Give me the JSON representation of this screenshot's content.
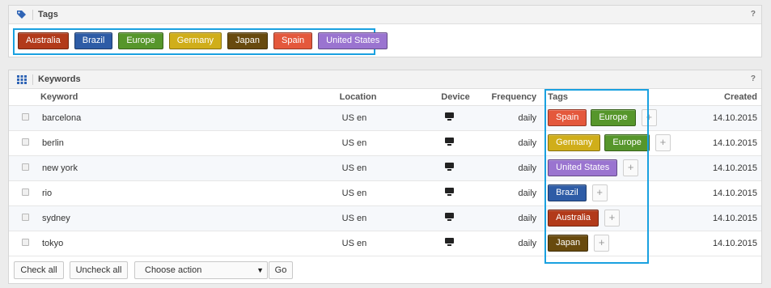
{
  "tags_panel": {
    "title": "Tags",
    "help": "?",
    "tags": [
      {
        "label": "Australia",
        "color": "#b23a1a"
      },
      {
        "label": "Brazil",
        "color": "#2e5ca6"
      },
      {
        "label": "Europe",
        "color": "#56962b"
      },
      {
        "label": "Germany",
        "color": "#d0ae1a"
      },
      {
        "label": "Japan",
        "color": "#684a0e"
      },
      {
        "label": "Spain",
        "color": "#e4583c"
      },
      {
        "label": "United States",
        "color": "#9a74d0"
      }
    ]
  },
  "keywords_panel": {
    "title": "Keywords",
    "help": "?",
    "columns": {
      "keyword": "Keyword",
      "location": "Location",
      "device": "Device",
      "frequency": "Frequency",
      "tags": "Tags",
      "created": "Created"
    },
    "rows": [
      {
        "keyword": "barcelona",
        "location": "US en",
        "frequency": "daily",
        "created": "14.10.2015",
        "tags": [
          "Spain",
          "Europe"
        ]
      },
      {
        "keyword": "berlin",
        "location": "US en",
        "frequency": "daily",
        "created": "14.10.2015",
        "tags": [
          "Germany",
          "Europe"
        ]
      },
      {
        "keyword": "new york",
        "location": "US en",
        "frequency": "daily",
        "created": "14.10.2015",
        "tags": [
          "United States"
        ]
      },
      {
        "keyword": "rio",
        "location": "US en",
        "frequency": "daily",
        "created": "14.10.2015",
        "tags": [
          "Brazil"
        ]
      },
      {
        "keyword": "sydney",
        "location": "US en",
        "frequency": "daily",
        "created": "14.10.2015",
        "tags": [
          "Australia"
        ]
      },
      {
        "keyword": "tokyo",
        "location": "US en",
        "frequency": "daily",
        "created": "14.10.2015",
        "tags": [
          "Japan"
        ]
      }
    ],
    "device_icon": "desktop-monitor-icon",
    "add_tag_glyph": "+"
  },
  "footer": {
    "check_all": "Check all",
    "uncheck_all": "Uncheck all",
    "action_select": "Choose action",
    "go": "Go"
  }
}
